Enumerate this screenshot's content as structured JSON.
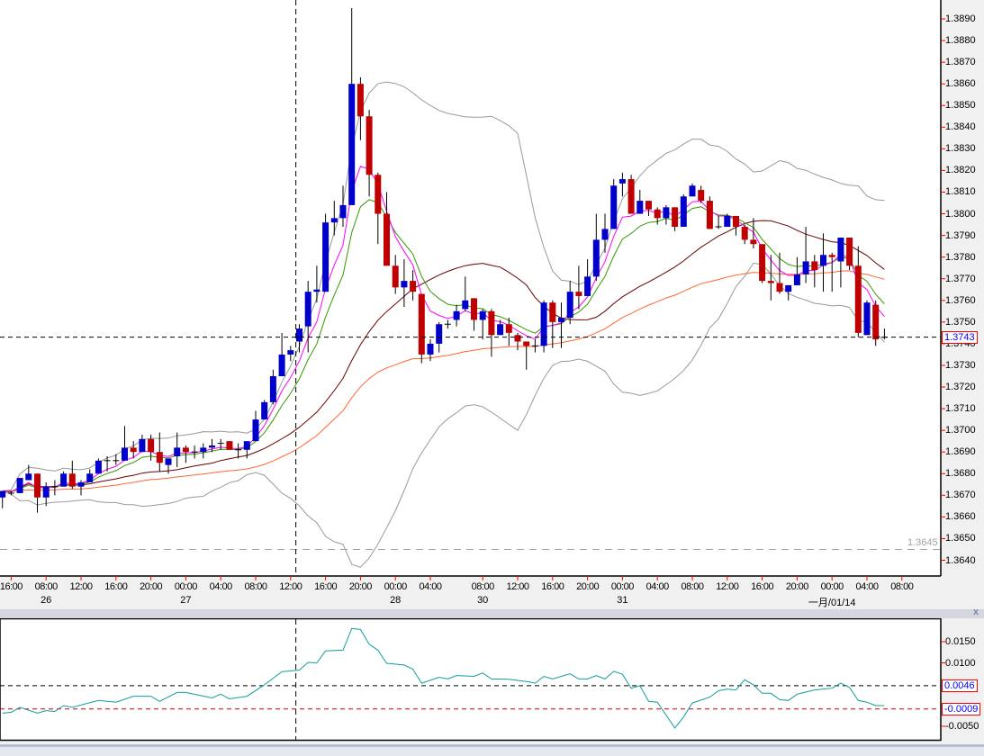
{
  "colors": {
    "bull": "#0000cc",
    "bear": "#c00000",
    "wick": "#000000",
    "ma_fast": "#ff00ff",
    "ma_mid": "#339900",
    "ma_slow": "#660000",
    "ma_long": "#ff6633",
    "bands": "#999999",
    "oscillator": "#139c9c",
    "level_line": "#a0a0a0"
  },
  "chart_data": [
    {
      "type": "candlestick",
      "title": "",
      "ylim": [
        1.3632,
        1.3898
      ],
      "y_ticks": [
        "1.3890",
        "1.3880",
        "1.3870",
        "1.3860",
        "1.3850",
        "1.3840",
        "1.3830",
        "1.3820",
        "1.3810",
        "1.3800",
        "1.3790",
        "1.3780",
        "1.3770",
        "1.3760",
        "1.3750",
        "1.3740",
        "1.3730",
        "1.3720",
        "1.3710",
        "1.3700",
        "1.3690",
        "1.3680",
        "1.3670",
        "1.3660",
        "1.3650",
        "1.3640"
      ],
      "current_price": "1.3743",
      "level_line": "1.3645",
      "candles_ohlc": [
        [
          1.3669,
          1.3672,
          1.3664,
          1.3672
        ],
        [
          1.3671,
          1.3672,
          1.367,
          1.3671
        ],
        [
          1.3671,
          1.3678,
          1.3671,
          1.3678
        ],
        [
          1.3677,
          1.3684,
          1.3677,
          1.368
        ],
        [
          1.368,
          1.368,
          1.3662,
          1.3669
        ],
        [
          1.3669,
          1.3676,
          1.3665,
          1.3674
        ],
        [
          1.3674,
          1.3677,
          1.367,
          1.3674
        ],
        [
          1.3674,
          1.3681,
          1.3674,
          1.368
        ],
        [
          1.368,
          1.3686,
          1.3673,
          1.3674
        ],
        [
          1.3674,
          1.3677,
          1.367,
          1.3676
        ],
        [
          1.3676,
          1.3682,
          1.3676,
          1.368
        ],
        [
          1.368,
          1.3687,
          1.368,
          1.3686
        ],
        [
          1.3686,
          1.3688,
          1.3681,
          1.3686
        ],
        [
          1.3686,
          1.3689,
          1.3684,
          1.3686
        ],
        [
          1.3686,
          1.3702,
          1.3686,
          1.3692
        ],
        [
          1.3692,
          1.3695,
          1.3687,
          1.369
        ],
        [
          1.369,
          1.3698,
          1.369,
          1.3696
        ],
        [
          1.3696,
          1.3698,
          1.3686,
          1.369
        ],
        [
          1.369,
          1.3699,
          1.3681,
          1.3685
        ],
        [
          1.3684,
          1.3687,
          1.368,
          1.3687
        ],
        [
          1.3688,
          1.3699,
          1.3683,
          1.3692
        ],
        [
          1.3692,
          1.3693,
          1.3685,
          1.369
        ],
        [
          1.369,
          1.3693,
          1.3687,
          1.369
        ],
        [
          1.369,
          1.3694,
          1.3687,
          1.3692
        ],
        [
          1.3692,
          1.3696,
          1.369,
          1.3693
        ],
        [
          1.3694,
          1.3696,
          1.3691,
          1.3694
        ],
        [
          1.3695,
          1.3695,
          1.3691,
          1.3691
        ],
        [
          1.3691,
          1.3694,
          1.3687,
          1.3691
        ],
        [
          1.3691,
          1.3695,
          1.3687,
          1.3695
        ],
        [
          1.3695,
          1.3709,
          1.3695,
          1.3705
        ],
        [
          1.3705,
          1.3714,
          1.3705,
          1.3713
        ],
        [
          1.3713,
          1.3728,
          1.3712,
          1.3725
        ],
        [
          1.3725,
          1.3745,
          1.3725,
          1.3735
        ],
        [
          1.3735,
          1.3739,
          1.3732,
          1.3737
        ],
        [
          1.3741,
          1.3749,
          1.3736,
          1.3747
        ],
        [
          1.3748,
          1.3769,
          1.3736,
          1.3764
        ],
        [
          1.3764,
          1.3776,
          1.3759,
          1.3765
        ],
        [
          1.3764,
          1.38,
          1.3764,
          1.3796
        ],
        [
          1.3796,
          1.3806,
          1.379,
          1.3798
        ],
        [
          1.3798,
          1.3813,
          1.3794,
          1.3804
        ],
        [
          1.3804,
          1.3895,
          1.3804,
          1.386
        ],
        [
          1.386,
          1.3863,
          1.3834,
          1.3845
        ],
        [
          1.3845,
          1.3848,
          1.3808,
          1.3818
        ],
        [
          1.3818,
          1.3819,
          1.3786,
          1.38
        ],
        [
          1.38,
          1.381,
          1.3776,
          1.3776
        ],
        [
          1.3776,
          1.3781,
          1.3763,
          1.3766
        ],
        [
          1.3766,
          1.3779,
          1.3757,
          1.3769
        ],
        [
          1.3769,
          1.3774,
          1.376,
          1.3764
        ],
        [
          1.3763,
          1.3763,
          1.3731,
          1.3735
        ],
        [
          1.3735,
          1.3742,
          1.3732,
          1.374
        ],
        [
          1.374,
          1.375,
          1.3736,
          1.3749
        ],
        [
          1.3749,
          1.3751,
          1.3747,
          1.3749
        ],
        [
          1.3751,
          1.3758,
          1.3748,
          1.3755
        ],
        [
          1.3756,
          1.3771,
          1.3755,
          1.376
        ],
        [
          1.3761,
          1.3761,
          1.3746,
          1.3751
        ],
        [
          1.3751,
          1.3756,
          1.3742,
          1.3755
        ],
        [
          1.3755,
          1.3756,
          1.3734,
          1.3744
        ],
        [
          1.3744,
          1.3751,
          1.3744,
          1.3749
        ],
        [
          1.3749,
          1.3752,
          1.3739,
          1.3745
        ],
        [
          1.3744,
          1.3745,
          1.3737,
          1.3741
        ],
        [
          1.3741,
          1.3741,
          1.3728,
          1.3739
        ],
        [
          1.3739,
          1.3742,
          1.3736,
          1.3739
        ],
        [
          1.3739,
          1.376,
          1.3736,
          1.3759
        ],
        [
          1.3759,
          1.376,
          1.3738,
          1.375
        ],
        [
          1.375,
          1.3759,
          1.3738,
          1.3752
        ],
        [
          1.3752,
          1.3769,
          1.3749,
          1.3764
        ],
        [
          1.3764,
          1.3776,
          1.3756,
          1.3762
        ],
        [
          1.3762,
          1.3779,
          1.3762,
          1.3771
        ],
        [
          1.3771,
          1.38,
          1.3769,
          1.3788
        ],
        [
          1.3788,
          1.38,
          1.3782,
          1.3793
        ],
        [
          1.3793,
          1.3816,
          1.3793,
          1.3813
        ],
        [
          1.3814,
          1.3819,
          1.3808,
          1.3816
        ],
        [
          1.3816,
          1.3818,
          1.38,
          1.38
        ],
        [
          1.38,
          1.3811,
          1.38,
          1.3806
        ],
        [
          1.3806,
          1.3806,
          1.3799,
          1.3802
        ],
        [
          1.3802,
          1.3803,
          1.3795,
          1.3798
        ],
        [
          1.3798,
          1.3804,
          1.3795,
          1.3803
        ],
        [
          1.3803,
          1.3803,
          1.3792,
          1.3794
        ],
        [
          1.3794,
          1.3809,
          1.3794,
          1.3808
        ],
        [
          1.3808,
          1.3814,
          1.3808,
          1.3813
        ],
        [
          1.3811,
          1.3813,
          1.3805,
          1.3806
        ],
        [
          1.3806,
          1.3808,
          1.3793,
          1.3793
        ],
        [
          1.3794,
          1.3799,
          1.3793,
          1.3794
        ],
        [
          1.3794,
          1.38,
          1.3794,
          1.3799
        ],
        [
          1.3799,
          1.3799,
          1.379,
          1.3794
        ],
        [
          1.3794,
          1.3795,
          1.3786,
          1.3788
        ],
        [
          1.3788,
          1.3798,
          1.3784,
          1.3786
        ],
        [
          1.3786,
          1.3786,
          1.3768,
          1.3769
        ],
        [
          1.3769,
          1.3781,
          1.376,
          1.3768
        ],
        [
          1.3768,
          1.3782,
          1.3763,
          1.3764
        ],
        [
          1.3764,
          1.3767,
          1.376,
          1.3767
        ],
        [
          1.3767,
          1.378,
          1.3767,
          1.3772
        ],
        [
          1.3772,
          1.3794,
          1.3768,
          1.3778
        ],
        [
          1.3778,
          1.3781,
          1.3766,
          1.3774
        ],
        [
          1.3776,
          1.3791,
          1.3764,
          1.3781
        ],
        [
          1.3781,
          1.3782,
          1.3764,
          1.378
        ],
        [
          1.3778,
          1.3789,
          1.3766,
          1.3789
        ],
        [
          1.3789,
          1.3789,
          1.3774,
          1.3776
        ],
        [
          1.3776,
          1.3785,
          1.3743,
          1.3745
        ],
        [
          1.3744,
          1.376,
          1.3744,
          1.3759
        ],
        [
          1.3758,
          1.376,
          1.3739,
          1.3742
        ],
        [
          1.3743,
          1.3747,
          1.3742,
          1.3743
        ]
      ],
      "indicators": {
        "ma_fast_period": 5,
        "ma_mid_period": 8,
        "ma_slow_period": 21,
        "ma_long_period": 50,
        "bands_period": 20,
        "bands_deviation": 2
      },
      "x_labels": [
        {
          "bar": 1,
          "time": "16:00",
          "date": ""
        },
        {
          "bar": 5,
          "time": "08:00",
          "date": "26"
        },
        {
          "bar": 9,
          "time": "12:00",
          "date": ""
        },
        {
          "bar": 13,
          "time": "16:00",
          "date": ""
        },
        {
          "bar": 17,
          "time": "20:00",
          "date": ""
        },
        {
          "bar": 21,
          "time": "00:00",
          "date": "27"
        },
        {
          "bar": 25,
          "time": "04:00",
          "date": ""
        },
        {
          "bar": 29,
          "time": "08:00",
          "date": ""
        },
        {
          "bar": 33,
          "time": "12:00",
          "date": ""
        },
        {
          "bar": 37,
          "time": "16:00",
          "date": ""
        },
        {
          "bar": 41,
          "time": "20:00",
          "date": ""
        },
        {
          "bar": 45,
          "time": "00:00",
          "date": "28"
        },
        {
          "bar": 49,
          "time": "04:00",
          "date": ""
        },
        {
          "bar": 55,
          "time": "08:00",
          "date": "30"
        },
        {
          "bar": 59,
          "time": "12:00",
          "date": ""
        },
        {
          "bar": 63,
          "time": "16:00",
          "date": ""
        },
        {
          "bar": 67,
          "time": "20:00",
          "date": ""
        },
        {
          "bar": 71,
          "time": "00:00",
          "date": "31"
        },
        {
          "bar": 75,
          "time": "04:00",
          "date": ""
        },
        {
          "bar": 79,
          "time": "08:00",
          "date": ""
        },
        {
          "bar": 83,
          "time": "12:00",
          "date": ""
        },
        {
          "bar": 87,
          "time": "16:00",
          "date": ""
        },
        {
          "bar": 91,
          "time": "20:00",
          "date": ""
        },
        {
          "bar": 95,
          "time": "00:00",
          "date": "一月/01/14"
        },
        {
          "bar": 99,
          "time": "04:00",
          "date": ""
        },
        {
          "bar": 103,
          "time": "08:00",
          "date": ""
        }
      ],
      "crosshair_bar": 33.6
    },
    {
      "type": "line",
      "title": "",
      "ylim": [
        -0.0072,
        0.021
      ],
      "y_ticks": [
        "0.0150",
        "0.0100",
        "-0.0050"
      ],
      "levels": [
        {
          "value": "0.0046",
          "color": "#000000"
        },
        {
          "value": "-0.0009",
          "color": "#cc0000"
        }
      ],
      "series_points": [
        [
          0,
          -0.0019
        ],
        [
          1,
          -0.0017
        ],
        [
          2,
          -0.0005
        ],
        [
          4,
          -0.0019
        ],
        [
          5,
          -0.0013
        ],
        [
          6,
          -0.0015
        ],
        [
          7,
          -0.0001
        ],
        [
          8,
          -0.0005
        ],
        [
          11,
          0.0011
        ],
        [
          13,
          0.0007
        ],
        [
          15,
          0.0021
        ],
        [
          17,
          0.0021
        ],
        [
          18,
          0.0009
        ],
        [
          20,
          0.003
        ],
        [
          21,
          0.003
        ],
        [
          24,
          0.0017
        ],
        [
          25,
          0.0026
        ],
        [
          26,
          0.0015
        ],
        [
          28,
          0.0021
        ],
        [
          30,
          0.0048
        ],
        [
          32,
          0.0079
        ],
        [
          34,
          0.0083
        ],
        [
          35,
          0.0101
        ],
        [
          36,
          0.01
        ],
        [
          37,
          0.0128
        ],
        [
          39,
          0.013
        ],
        [
          40,
          0.0181
        ],
        [
          41,
          0.0179
        ],
        [
          42,
          0.0144
        ],
        [
          43,
          0.013
        ],
        [
          44,
          0.0099
        ],
        [
          46,
          0.0095
        ],
        [
          47,
          0.0085
        ],
        [
          48,
          0.0052
        ],
        [
          50,
          0.0066
        ],
        [
          51,
          0.0062
        ],
        [
          52,
          0.007
        ],
        [
          54,
          0.0068
        ],
        [
          55,
          0.0076
        ],
        [
          56,
          0.0062
        ],
        [
          58,
          0.0061
        ],
        [
          60,
          0.0056
        ],
        [
          61,
          0.0052
        ],
        [
          62,
          0.0068
        ],
        [
          63,
          0.0062
        ],
        [
          65,
          0.0074
        ],
        [
          66,
          0.0062
        ],
        [
          67,
          0.0062
        ],
        [
          68,
          0.007
        ],
        [
          69,
          0.0062
        ],
        [
          70,
          0.008
        ],
        [
          71,
          0.0073
        ],
        [
          72,
          0.004
        ],
        [
          73,
          0.0046
        ],
        [
          74,
          0.0009
        ],
        [
          75,
          0.0007
        ],
        [
          77,
          -0.0054
        ],
        [
          78,
          -0.0028
        ],
        [
          79,
          0.0005
        ],
        [
          81,
          0.0019
        ],
        [
          82,
          0.0034
        ],
        [
          83,
          0.0038
        ],
        [
          84,
          0.0036
        ],
        [
          85,
          0.006
        ],
        [
          86,
          0.0048
        ],
        [
          87,
          0.0028
        ],
        [
          88,
          0.0028
        ],
        [
          89,
          0.0013
        ],
        [
          90,
          0.0011
        ],
        [
          91,
          0.0026
        ],
        [
          93,
          0.0036
        ],
        [
          95,
          0.004
        ],
        [
          96,
          0.0052
        ],
        [
          97,
          0.0042
        ],
        [
          98,
          0.0011
        ],
        [
          99,
          0.0007
        ],
        [
          100,
          -0.0001
        ],
        [
          101,
          -0.0001
        ]
      ]
    }
  ],
  "close_pane_label": "x"
}
